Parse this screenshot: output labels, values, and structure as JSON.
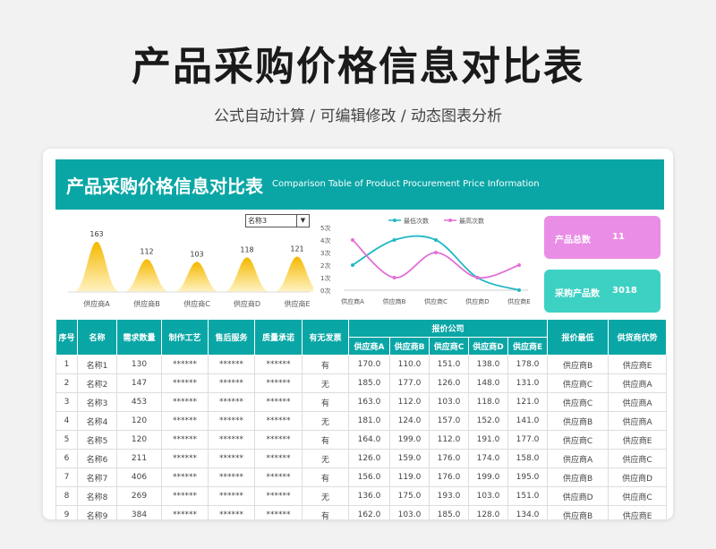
{
  "page": {
    "title": "产品采购价格信息对比表",
    "subtitle": "公式自动计算 /  可编辑修改  / 动态图表分析"
  },
  "banner": {
    "title_cn": "产品采购价格信息对比表",
    "title_en": "Comparison Table of Product Procurement Price Information"
  },
  "selector": {
    "value": "名称3",
    "arrow": "▼"
  },
  "kpis": [
    {
      "label": "产品总数",
      "value": "11",
      "color": "#ea8de6"
    },
    {
      "label": "采购产品数",
      "value": "3018",
      "color": "#3dd1c3"
    }
  ],
  "chart_data": [
    {
      "type": "area",
      "categories": [
        "供应商A",
        "供应商B",
        "供应商C",
        "供应商D",
        "供应商E"
      ],
      "values": [
        163,
        112,
        103,
        118,
        121
      ],
      "colors": {
        "fill_top": "#f5b800",
        "fill_bottom": "#fff3c4"
      }
    },
    {
      "type": "line",
      "categories": [
        "供应商A",
        "供应商B",
        "供应商C",
        "供应商D",
        "供应商E"
      ],
      "ylim": [
        0,
        5
      ],
      "yticks": [
        "0次",
        "1次",
        "2次",
        "3次",
        "4次",
        "5次"
      ],
      "legend_position": "top",
      "series": [
        {
          "name": "最低次数",
          "values": [
            2,
            4,
            4,
            1,
            0
          ],
          "color": "#1fb8c4"
        },
        {
          "name": "最高次数",
          "values": [
            4,
            1,
            3,
            1,
            2
          ],
          "color": "#e36fd6"
        }
      ]
    }
  ],
  "table": {
    "headers": {
      "no": "序号",
      "name": "名称",
      "demand": "需求数量",
      "craft": "制作工艺",
      "service": "售后服务",
      "quality": "质量承诺",
      "invoice": "有无发票",
      "quote_group": "报价公司",
      "lowest": "报价最低",
      "best": "供货商优势"
    },
    "suppliers": [
      "供应商A",
      "供应商B",
      "供应商C",
      "供应商D",
      "供应商E"
    ],
    "rows": [
      [
        "1",
        "名称1",
        "130",
        "******",
        "******",
        "******",
        "有",
        "170.0",
        "110.0",
        "151.0",
        "138.0",
        "178.0",
        "供应商B",
        "供应商E"
      ],
      [
        "2",
        "名称2",
        "147",
        "******",
        "******",
        "******",
        "无",
        "185.0",
        "177.0",
        "126.0",
        "148.0",
        "131.0",
        "供应商C",
        "供应商A"
      ],
      [
        "3",
        "名称3",
        "453",
        "******",
        "******",
        "******",
        "有",
        "163.0",
        "112.0",
        "103.0",
        "118.0",
        "121.0",
        "供应商C",
        "供应商A"
      ],
      [
        "4",
        "名称4",
        "120",
        "******",
        "******",
        "******",
        "无",
        "181.0",
        "124.0",
        "157.0",
        "152.0",
        "141.0",
        "供应商B",
        "供应商A"
      ],
      [
        "5",
        "名称5",
        "120",
        "******",
        "******",
        "******",
        "有",
        "164.0",
        "199.0",
        "112.0",
        "191.0",
        "177.0",
        "供应商C",
        "供应商E"
      ],
      [
        "6",
        "名称6",
        "211",
        "******",
        "******",
        "******",
        "无",
        "126.0",
        "159.0",
        "176.0",
        "174.0",
        "158.0",
        "供应商A",
        "供应商C"
      ],
      [
        "7",
        "名称7",
        "406",
        "******",
        "******",
        "******",
        "有",
        "156.0",
        "119.0",
        "176.0",
        "199.0",
        "195.0",
        "供应商B",
        "供应商D"
      ],
      [
        "8",
        "名称8",
        "269",
        "******",
        "******",
        "******",
        "无",
        "136.0",
        "175.0",
        "193.0",
        "103.0",
        "151.0",
        "供应商D",
        "供应商C"
      ],
      [
        "9",
        "名称9",
        "384",
        "******",
        "******",
        "******",
        "有",
        "162.0",
        "103.0",
        "185.0",
        "128.0",
        "134.0",
        "供应商B",
        "供应商E"
      ]
    ]
  }
}
